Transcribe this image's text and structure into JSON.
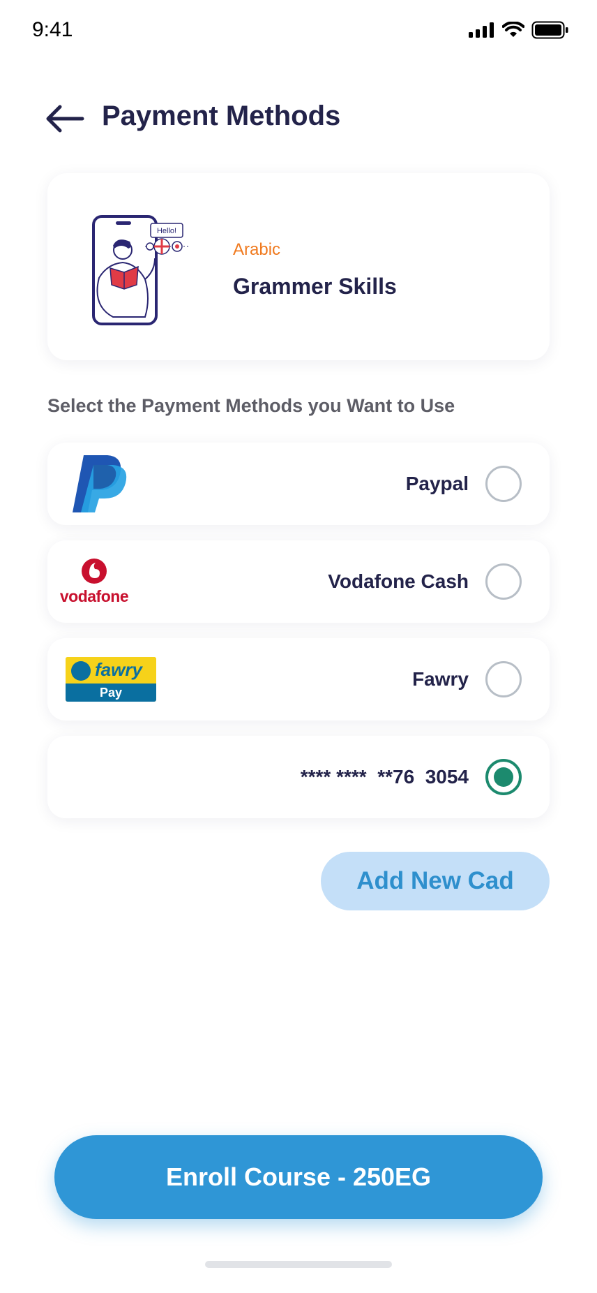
{
  "status_bar": {
    "time": "9:41"
  },
  "header": {
    "title": "Payment Methods"
  },
  "course": {
    "language": "Arabic",
    "name": "Grammer Skills",
    "speech_bubble": "Hello!"
  },
  "instruction": "Select the Payment Methods you Want to Use",
  "payment_methods": [
    {
      "label": "Paypal",
      "logo": "paypal-logo",
      "selected": false
    },
    {
      "label": "Vodafone Cash",
      "logo": "vodafone-logo",
      "logo_text": "vodafone",
      "selected": false
    },
    {
      "label": "Fawry",
      "logo": "fawry-logo",
      "logo_text": "fawry",
      "logo_subtext": "Pay",
      "selected": false
    },
    {
      "label": "**** ****  **76  3054",
      "logo": "",
      "selected": true
    }
  ],
  "add_card_label": "Add New Cad",
  "enroll_label": "Enroll Course - 250EG",
  "colors": {
    "primary": "#2f96d6",
    "accent_orange": "#f07a1f",
    "radio_selected": "#1c8a6e",
    "text_dark": "#23234a"
  }
}
